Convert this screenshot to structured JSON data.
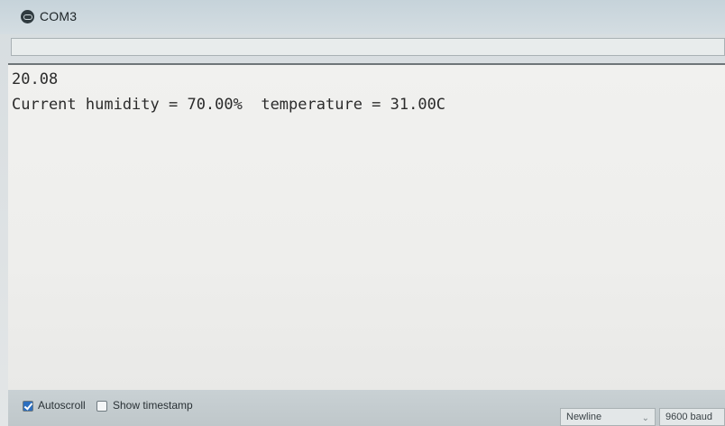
{
  "window": {
    "title": "COM3"
  },
  "send": {
    "value": ""
  },
  "serial_output": {
    "lines": [
      "20.08",
      "Current humidity = 70.00%  temperature = 31.00C"
    ]
  },
  "footer": {
    "autoscroll_label": "Autoscroll",
    "autoscroll_checked": true,
    "timestamp_label": "Show timestamp",
    "timestamp_checked": false,
    "line_ending": "Newline",
    "baud_rate": "9600 baud"
  },
  "icons": {
    "app": "serial-monitor-icon",
    "line_ending_chevron": "chevron-down-icon"
  },
  "colors": {
    "accent": "#2c6fbf",
    "output_bg": "#efefed",
    "text": "#2b2b2b"
  }
}
